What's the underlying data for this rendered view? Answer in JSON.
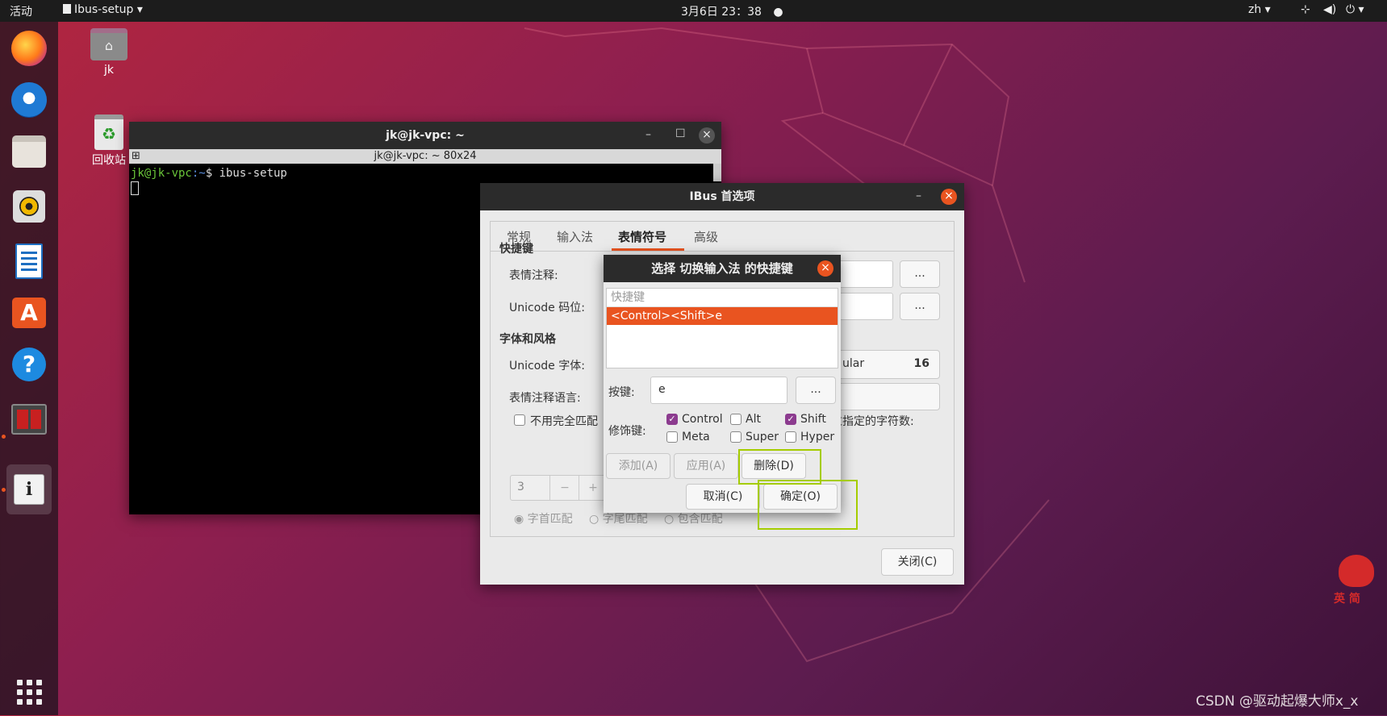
{
  "topbar": {
    "activities": "活动",
    "app_menu": "Ibus-setup",
    "clock": "3月6日  23：38",
    "lang": "zh"
  },
  "desktop": {
    "home_label": "jk",
    "trash_label": "回收站"
  },
  "terminal": {
    "title": "jk@jk-vpc: ~",
    "subtitle": "jk@jk-vpc: ~ 80x24",
    "prompt_user": "jk@jk-vpc",
    "prompt_path": ":~",
    "prompt_symbol": "$ ",
    "command": "ibus-setup"
  },
  "prefs": {
    "title": "IBus 首选项",
    "tabs": [
      "常规",
      "输入法",
      "表情符号",
      "高级"
    ],
    "active_tab": "表情符号",
    "section_shortcut": "快捷键",
    "emoji_annotation": "表情注释:",
    "unicode_codepoint": "Unicode 码位:",
    "section_font": "字体和风格",
    "unicode_font": "Unicode 字体:",
    "font_fragment": "ular",
    "font_size": "16",
    "annotation_lang": "表情注释语言:",
    "exact_match": "不用完全匹配",
    "exceed_chars": "超过指定的字符数:",
    "spin_value": "3",
    "match_prefix": "字首匹配",
    "match_suffix": "字尾匹配",
    "match_contain": "包含匹配",
    "close": "关闭(C)",
    "ellipsis": "..."
  },
  "dialog": {
    "title": "选择 切换输入法 的快捷键",
    "list_header": "快捷键",
    "list_item": "<Control><Shift>e",
    "key_label": "按键:",
    "key_value": "e",
    "key_button": "...",
    "modifier_label": "修饰键:",
    "modifiers": {
      "control": "Control",
      "alt": "Alt",
      "shift": "Shift",
      "meta": "Meta",
      "super": "Super",
      "hyper": "Hyper"
    },
    "add": "添加(A)",
    "apply": "应用(A)",
    "delete": "删除(D)",
    "cancel": "取消(C)",
    "ok": "确定(O)"
  },
  "watermark": "CSDN @驱动起爆大师x_x",
  "mascot_text": "英 简",
  "colors": {
    "accent": "#e95420",
    "checkbox": "#8c3b8f",
    "highlight": "#a5cc00"
  }
}
